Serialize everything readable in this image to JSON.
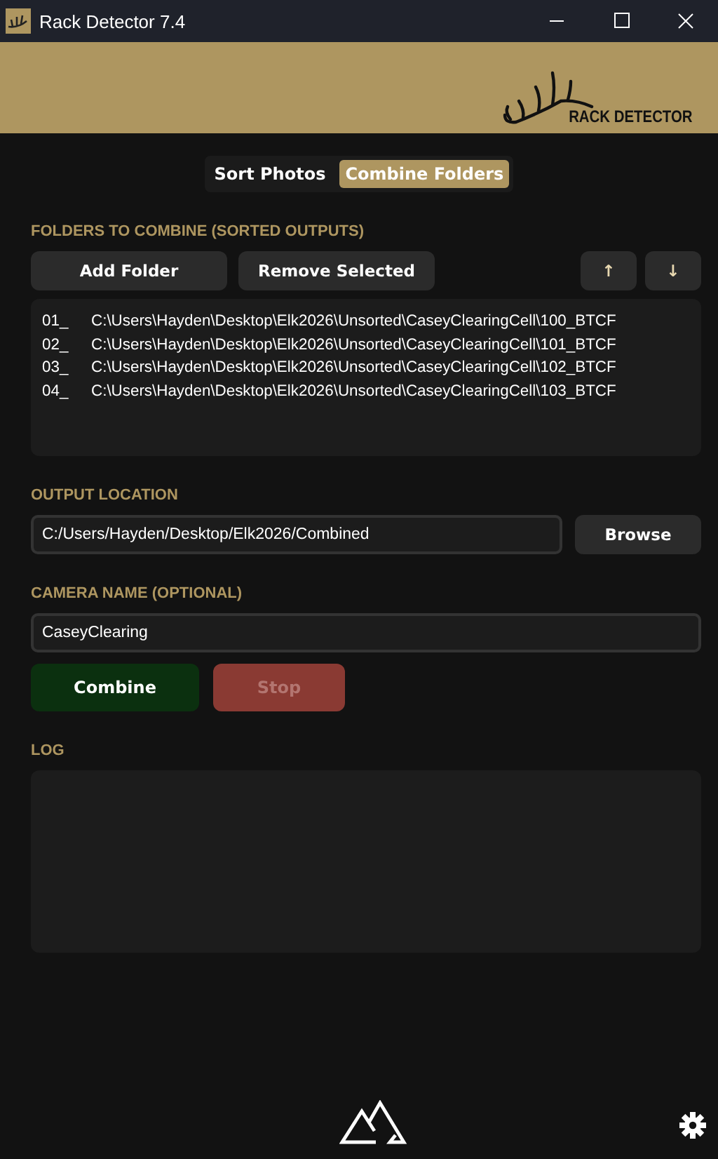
{
  "window": {
    "title": "Rack Detector 7.4"
  },
  "banner": {
    "logo_text": "RACK DETECTOR"
  },
  "tabs": [
    {
      "label": "Sort Photos",
      "selected": false
    },
    {
      "label": "Combine Folders",
      "selected": true
    }
  ],
  "folders": {
    "label": "FOLDERS TO COMBINE (SORTED OUTPUTS)",
    "buttons": [
      {
        "label": "Add Folder",
        "kind": "wide"
      },
      {
        "label": "Remove Selected",
        "kind": "wide"
      },
      {
        "label": "↑",
        "kind": "small"
      },
      {
        "label": "↓",
        "kind": "small"
      }
    ],
    "items": [
      {
        "index": "01_",
        "path": "C:\\Users\\Hayden\\Desktop\\Elk2026\\Unsorted\\CaseyClearingCell\\100_BTCF"
      },
      {
        "index": "02_",
        "path": "C:\\Users\\Hayden\\Desktop\\Elk2026\\Unsorted\\CaseyClearingCell\\101_BTCF"
      },
      {
        "index": "03_",
        "path": "C:\\Users\\Hayden\\Desktop\\Elk2026\\Unsorted\\CaseyClearingCell\\102_BTCF"
      },
      {
        "index": "04_",
        "path": "C:\\Users\\Hayden\\Desktop\\Elk2026\\Unsorted\\CaseyClearingCell\\103_BTCF"
      }
    ]
  },
  "output": {
    "label": "OUTPUT LOCATION",
    "value": "C:/Users/Hayden/Desktop/Elk2026/Combined",
    "button": "Browse"
  },
  "camera": {
    "label": "CAMERA NAME (OPTIONAL)",
    "value": "CaseyClearing"
  },
  "actions": [
    {
      "label": "Combine",
      "kind": "go",
      "disabled": false
    },
    {
      "label": "Stop",
      "kind": "stop",
      "disabled": true
    }
  ],
  "log": {
    "label": "LOG"
  }
}
